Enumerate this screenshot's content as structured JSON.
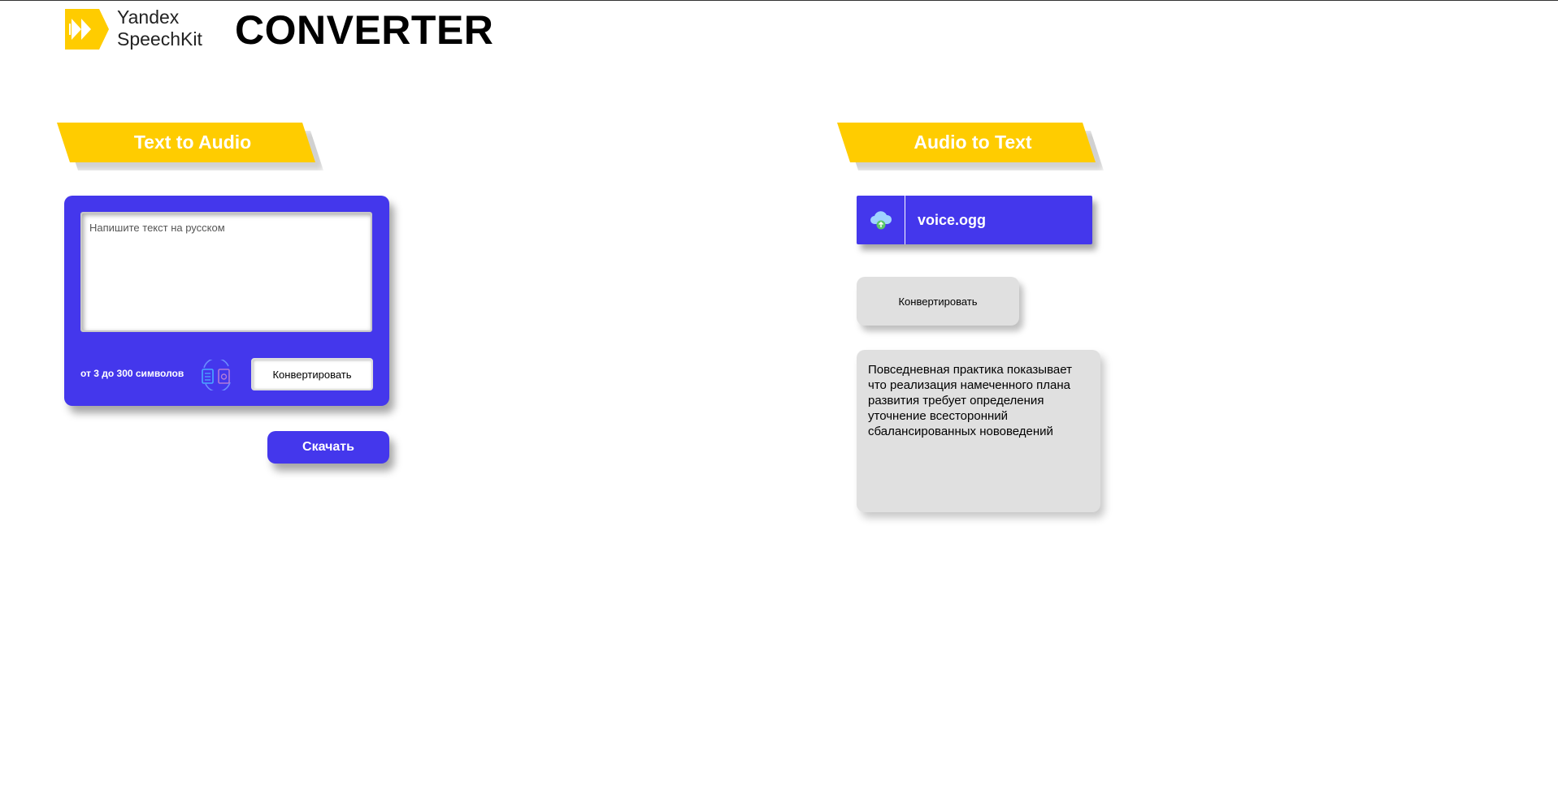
{
  "header": {
    "brand_line1": "Yandex",
    "brand_line2": "SpeechKit",
    "title": "CONVERTER",
    "logo_icon": "speechkit-logo-icon"
  },
  "text_to_audio": {
    "banner": "Text to Audio",
    "textarea_placeholder": "Напишите текст на русском",
    "textarea_value": "",
    "limit_hint": "от 3 до 300 символов",
    "convert_label": "Конвертировать",
    "download_label": "Скачать",
    "convert_icon": "text-to-audio-convert-icon"
  },
  "audio_to_text": {
    "banner": "Audio to Text",
    "file_name": "voice.ogg",
    "upload_icon": "cloud-upload-icon",
    "convert_label": "Конвертировать",
    "result_text": "Повседневная практика показывает что реализация намеченного плана развития требует определения уточнение всесторонний сбалансированных нововедений"
  },
  "colors": {
    "accent": "#4437ec",
    "banner": "#ffcc00",
    "neutral": "#e0e0e0"
  }
}
